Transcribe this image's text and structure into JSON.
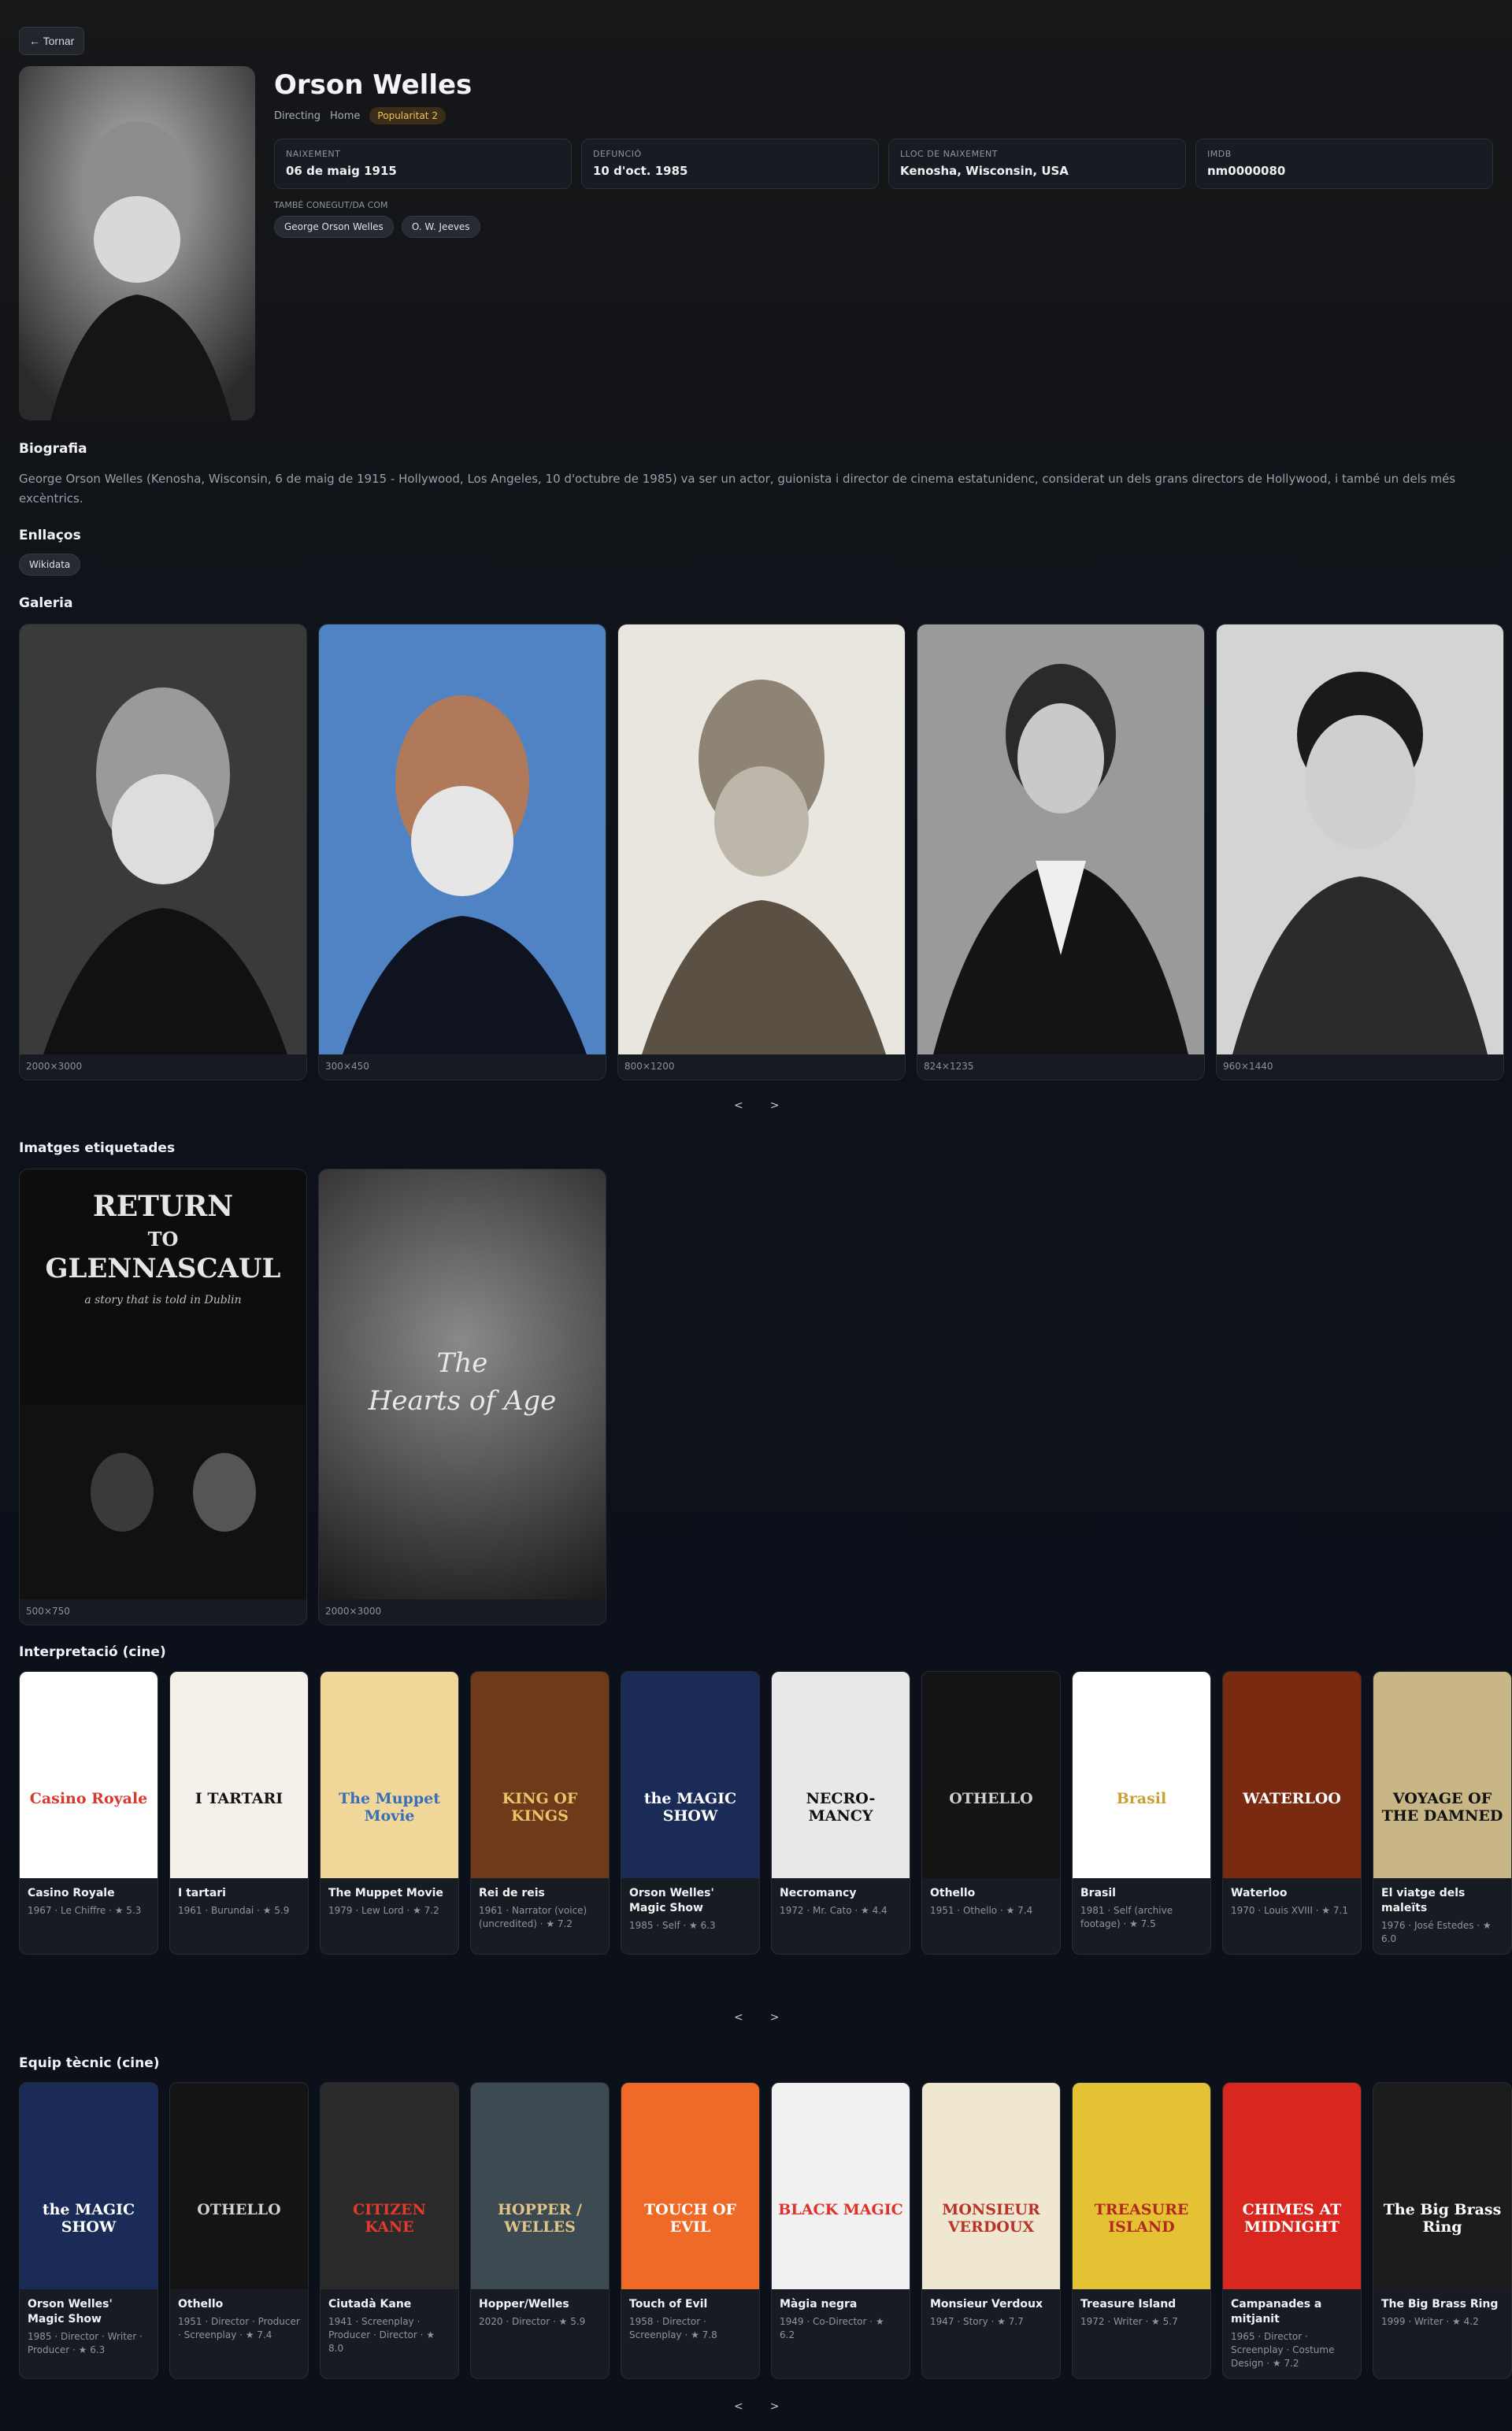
{
  "nav": {
    "back_label": "← Tornar"
  },
  "person": {
    "name": "Orson Welles",
    "department": "Directing",
    "gender": "Home",
    "popularity": "Popularitat 2",
    "facts": [
      {
        "label": "NAIXEMENT",
        "value": "06 de maig 1915"
      },
      {
        "label": "DEFUNCIÓ",
        "value": "10 d'oct. 1985"
      },
      {
        "label": "LLOC DE NAIXEMENT",
        "value": "Kenosha, Wisconsin, USA"
      },
      {
        "label": "IMDB",
        "value": "nm0000080"
      }
    ],
    "aka_label": "TAMBÉ CONEGUT/DA COM",
    "aka": [
      "George Orson Welles",
      "O. W. Jeeves"
    ]
  },
  "bio": {
    "title": "Biografia",
    "text": "George Orson Welles (Kenosha, Wisconsin, 6 de maig de 1915 - Hollywood, Los Angeles, 10 d'octubre de 1985) va ser un actor, guionista i director de cinema estatunidenc, considerat un dels grans directors de Hollywood, i també un dels més excèntrics."
  },
  "links": {
    "title": "Enllaços",
    "items": [
      "Wikidata"
    ]
  },
  "gallery": {
    "title": "Galeria",
    "items": [
      {
        "dim": "2000×3000",
        "bg": "#5a5a5a"
      },
      {
        "dim": "300×450",
        "bg": "#4f83c4"
      },
      {
        "dim": "800×1200",
        "bg": "#d8d4cc"
      },
      {
        "dim": "824×1235",
        "bg": "#8b8b8b"
      },
      {
        "dim": "960×1440",
        "bg": "#b8b8b8"
      }
    ],
    "prev": "<",
    "next": ">"
  },
  "tagged": {
    "title": "Imatges etiquetades",
    "items": [
      {
        "dim": "500×750",
        "t1": "RETURN",
        "t2": "TO",
        "t3": "GLENNASCAUL",
        "t4": "a story that is told in Dublin"
      },
      {
        "dim": "2000×3000",
        "t1": "The",
        "t2": "Hearts of Age"
      }
    ]
  },
  "acting": {
    "title": "Interpretació (cine)",
    "prev": "<",
    "next": ">",
    "items": [
      {
        "title": "Casino Royale",
        "sub": "1967 · Le Chiffre · ★ 5.3",
        "bg": "#ffffff",
        "fg": "#d8382e",
        "ptext": "Casino Royale"
      },
      {
        "title": "I tartari",
        "sub": "1961 · Burundai · ★ 5.9",
        "bg": "#f4f1ea",
        "fg": "#151515",
        "ptext": "I TARTARI"
      },
      {
        "title": "The Muppet Movie",
        "sub": "1979 · Lew Lord · ★ 7.2",
        "bg": "#f2d79a",
        "fg": "#3a6fb5",
        "ptext": "The Muppet Movie"
      },
      {
        "title": "Rei de reis",
        "sub": "1961 · Narrator (voice) (uncredited) · ★ 7.2",
        "bg": "#6e3a1a",
        "fg": "#e9c56a",
        "ptext": "KING OF KINGS"
      },
      {
        "title": "Orson Welles' Magic Show",
        "sub": "1985 · Self · ★ 6.3",
        "bg": "#1b2b58",
        "fg": "#ffffff",
        "ptext": "the MAGIC SHOW"
      },
      {
        "title": "Necromancy",
        "sub": "1972 · Mr. Cato · ★ 4.4",
        "bg": "#e8e8e8",
        "fg": "#111111",
        "ptext": "NECRO-MANCY"
      },
      {
        "title": "Othello",
        "sub": "1951 · Othello · ★ 7.4",
        "bg": "#141414",
        "fg": "#cfcfcf",
        "ptext": "OTHELLO"
      },
      {
        "title": "Brasil",
        "sub": "1981 · Self (archive footage) · ★ 7.5",
        "bg": "#ffffff",
        "fg": "#c7a135",
        "ptext": "Brasil"
      },
      {
        "title": "Waterloo",
        "sub": "1970 · Louis XVIII · ★ 7.1",
        "bg": "#7a2a10",
        "fg": "#ffffff",
        "ptext": "WATERLOO"
      },
      {
        "title": "El viatge dels maleïts",
        "sub": "1976 · José Estedes · ★ 6.0",
        "bg": "#c9b687",
        "fg": "#111111",
        "ptext": "VOYAGE OF THE DAMNED"
      }
    ]
  },
  "crew": {
    "title": "Equip tècnic (cine)",
    "prev": "<",
    "next": ">",
    "items": [
      {
        "title": "Orson Welles' Magic Show",
        "sub": "1985 · Director · Writer · Producer · ★ 6.3",
        "bg": "#1b2b58",
        "fg": "#ffffff",
        "ptext": "the MAGIC SHOW"
      },
      {
        "title": "Othello",
        "sub": "1951 · Director · Producer · Screenplay · ★ 7.4",
        "bg": "#141414",
        "fg": "#cfcfcf",
        "ptext": "OTHELLO"
      },
      {
        "title": "Ciutadà Kane",
        "sub": "1941 · Screenplay · Producer · Director · ★ 8.0",
        "bg": "#2b2b2b",
        "fg": "#e23a2c",
        "ptext": "CITIZEN KANE"
      },
      {
        "title": "Hopper/Welles",
        "sub": "2020 · Director · ★ 5.9",
        "bg": "#3e4a52",
        "fg": "#e0c48a",
        "ptext": "HOPPER / WELLES"
      },
      {
        "title": "Touch of Evil",
        "sub": "1958 · Director · Screenplay · ★ 7.8",
        "bg": "#ef6a26",
        "fg": "#ffffff",
        "ptext": "TOUCH OF EVIL"
      },
      {
        "title": "Màgia negra",
        "sub": "1949 · Co-Director · ★ 6.2",
        "bg": "#f1f1f1",
        "fg": "#e0312a",
        "ptext": "BLACK MAGIC"
      },
      {
        "title": "Monsieur Verdoux",
        "sub": "1947 · Story · ★ 7.7",
        "bg": "#efe7cf",
        "fg": "#b8342a",
        "ptext": "MONSIEUR VERDOUX"
      },
      {
        "title": "Treasure Island",
        "sub": "1972 · Writer · ★ 5.7",
        "bg": "#e5c233",
        "fg": "#b22a1d",
        "ptext": "TREASURE ISLAND"
      },
      {
        "title": "Campanades a mitjanit",
        "sub": "1965 · Director · Screenplay · Costume Design · ★ 7.2",
        "bg": "#d9261e",
        "fg": "#ffffff",
        "ptext": "CHIMES AT MIDNIGHT"
      },
      {
        "title": "The Big Brass Ring",
        "sub": "1999 · Writer · ★ 4.2",
        "bg": "#1c1c1c",
        "fg": "#ffffff",
        "ptext": "The Big Brass Ring"
      }
    ]
  }
}
